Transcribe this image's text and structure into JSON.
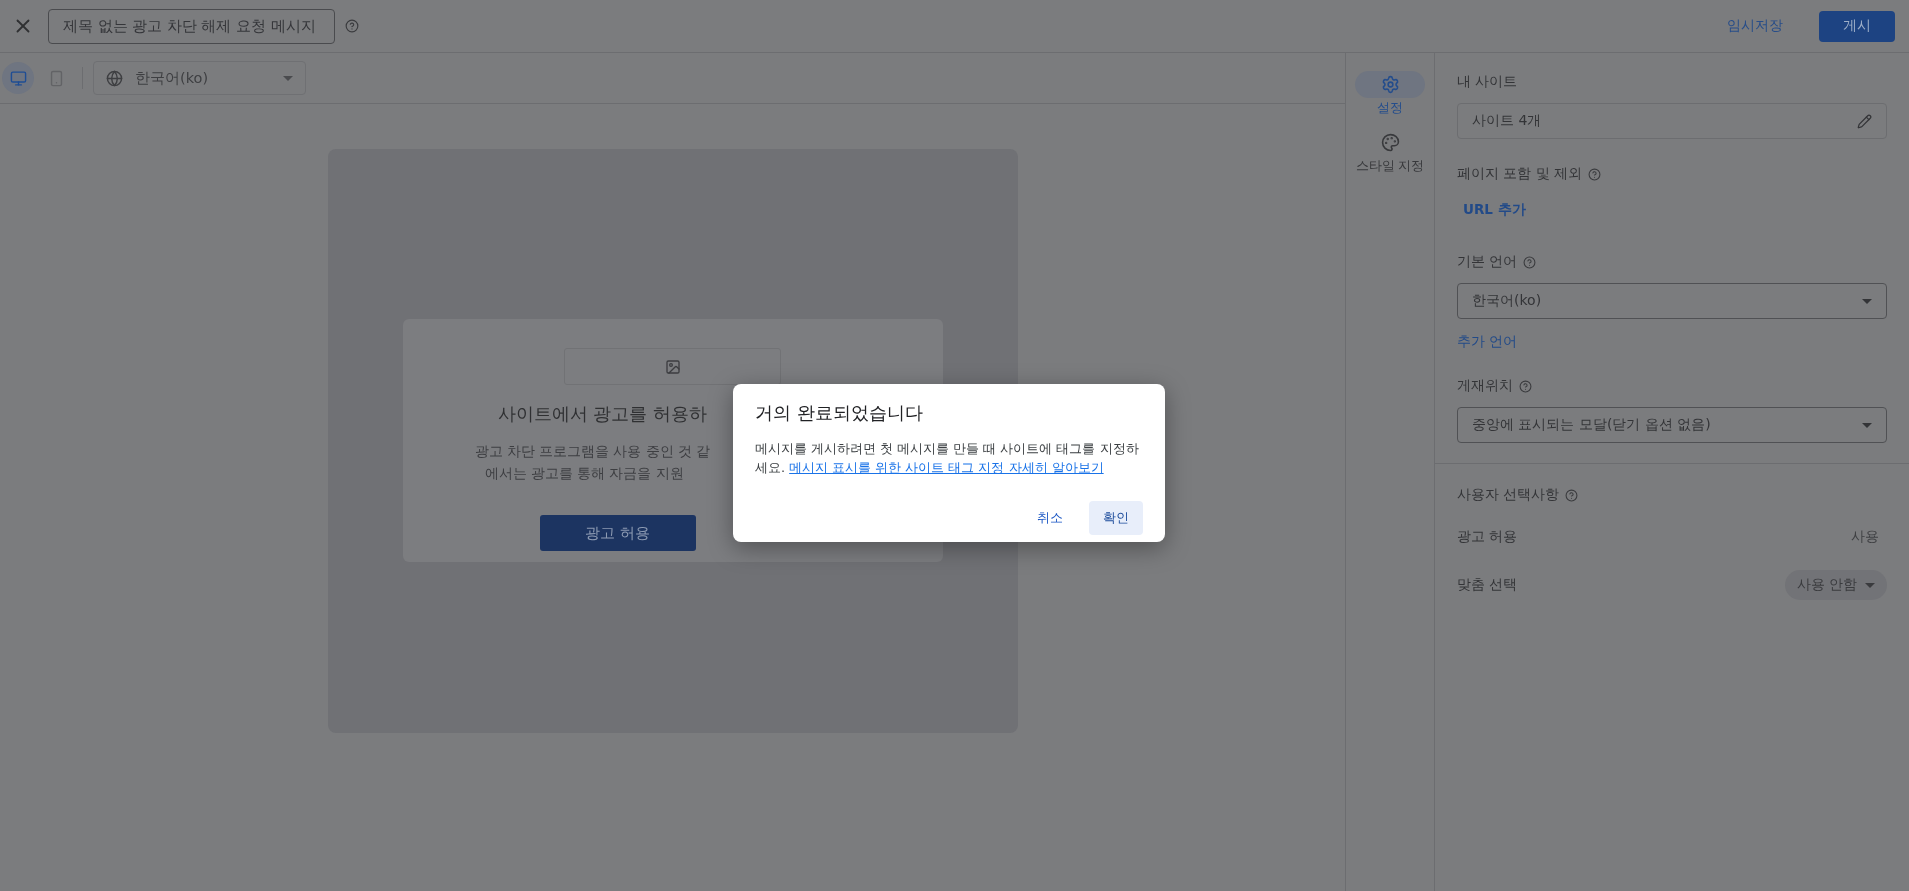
{
  "toolbar": {
    "title_field": {
      "value": "제목 없는 광고 차단 해제 요청 메시지"
    },
    "draft_button": "임시저장",
    "publish_button": "게시"
  },
  "preview_bar": {
    "devices": [
      {
        "kind": "desktop",
        "selected": true
      },
      {
        "kind": "mobile",
        "selected": false
      }
    ],
    "language": {
      "value": "한국어(ko)",
      "disabled": true
    }
  },
  "preview": {
    "heading": "사이트에서 광고를 허용하",
    "lines": [
      "광고 차단 프로그램을 사용 중인 것 같",
      "에서는 광고를 통해 자금을 지원"
    ],
    "button": "광고 허용"
  },
  "rail": [
    {
      "kind": "settings",
      "label": "설정",
      "selected": true
    },
    {
      "kind": "style",
      "label": "스타일 지정",
      "selected": false
    }
  ],
  "panel": {
    "sites": {
      "label": "내 사이트",
      "value": "사이트 4개"
    },
    "pages": {
      "label": "페이지 포함 및 제외",
      "link": "URL 추가"
    },
    "language": {
      "label": "기본 언어",
      "value": "한국어(ko)",
      "link": "추가 언어"
    },
    "placement": {
      "label": "게재위치",
      "value": "중앙에 표시되는 모달(닫기 옵션 없음)"
    },
    "choices": {
      "label": "사용자 선택사항",
      "rows": [
        {
          "kind": "static",
          "label": "광고 허용",
          "value": "사용"
        },
        {
          "kind": "dropdown",
          "label": "맞춤 선택",
          "value": "사용 안함"
        }
      ]
    }
  },
  "dialog": {
    "title": "거의 완료되었습니다",
    "body": "메시지를 게시하려면 첫 메시지를 만들 때 사이트에 태그를 지정하세요.",
    "link": "메시지 표시를 위한 사이트 태그 지정 자세히 알아보기",
    "buttons": [
      {
        "kind": "text",
        "label": "취소"
      },
      {
        "kind": "tonal",
        "label": "확인"
      }
    ]
  }
}
